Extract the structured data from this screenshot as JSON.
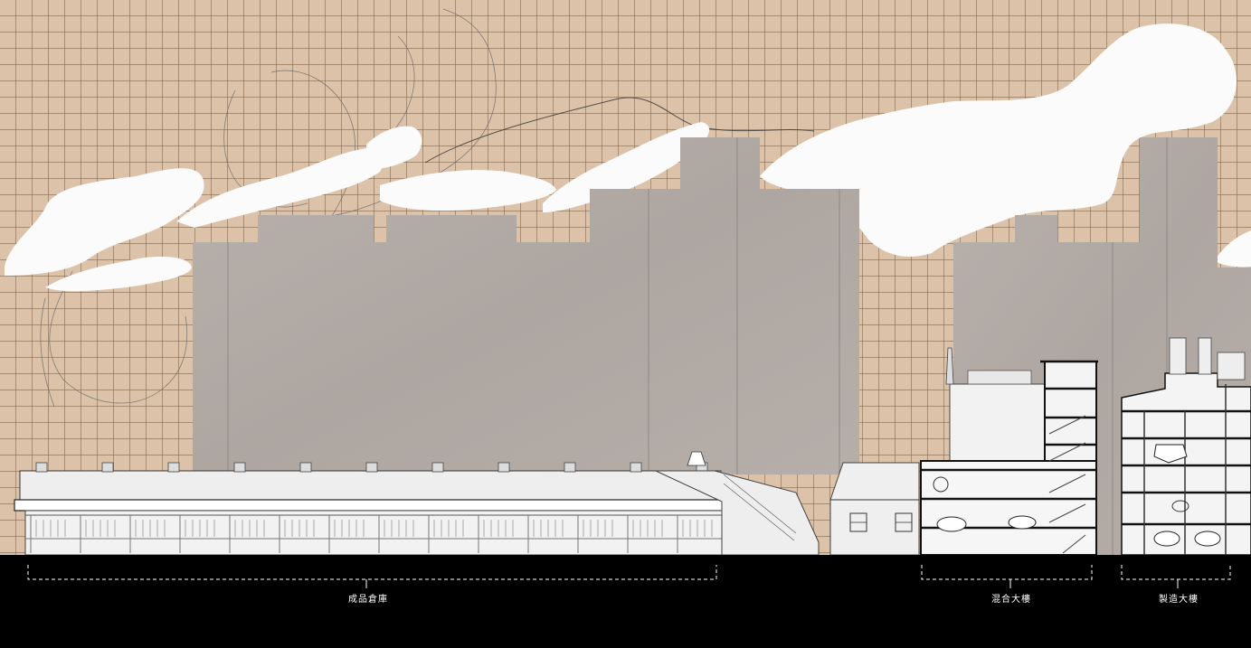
{
  "drawing": {
    "colors": {
      "sky": "#dcc2a8",
      "grid": "#6e6e6e",
      "cloud": "#fbfbfb",
      "wall": "#b3aba6",
      "wall_seam": "#8f8884",
      "building": "#efefef",
      "ground": "#000000",
      "dimension_line": "#ffffff"
    },
    "zones": [
      {
        "id": "warehouse",
        "label": "成品倉庫"
      },
      {
        "id": "building-a",
        "label": "混合大樓"
      },
      {
        "id": "building-b",
        "label": "製造大樓"
      }
    ]
  }
}
